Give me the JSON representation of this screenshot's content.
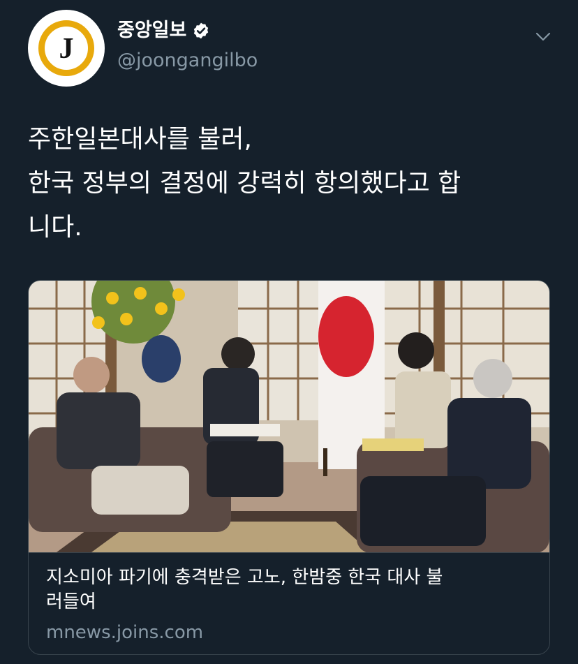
{
  "account": {
    "display_name": "중앙일보",
    "handle": "@joongangilbo",
    "avatar_letter": "J",
    "avatar_ring_color": "#e8a90c",
    "verified": true
  },
  "tweet": {
    "text": "주한일본대사를 불러,\n한국 정부의 결정에 강력히 항의했다고 합\n니다."
  },
  "card": {
    "title": "지소미아 파기에 충격받은 고노, 한밤중 한국 대사 불\n러들여",
    "domain": "mnews.joins.com"
  },
  "icons": {
    "verified": "verified-badge-icon",
    "menu": "chevron-down-icon"
  }
}
